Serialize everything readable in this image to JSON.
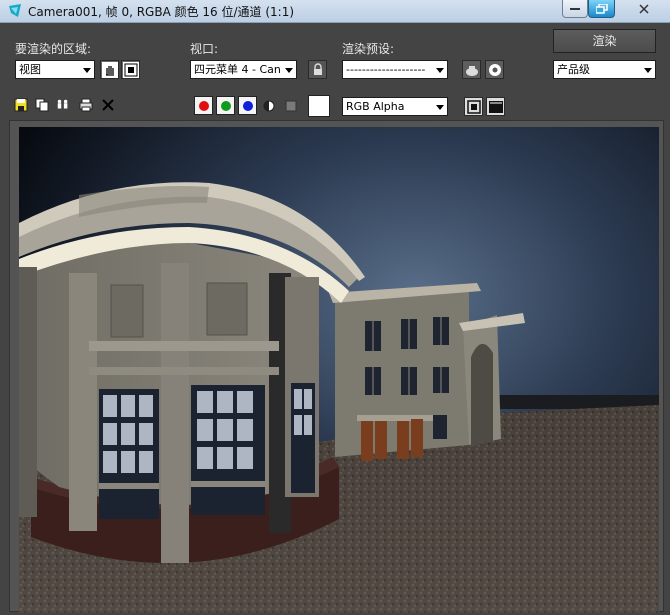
{
  "window": {
    "title": "Camera001, 帧 0, RGBA 颜色 16 位/通道 (1:1)"
  },
  "toolbar": {
    "area_label": "要渲染的区域:",
    "area_value": "视图",
    "viewport_label": "视口:",
    "viewport_value": "四元菜单 4 - Can",
    "preset_label": "渲染预设:",
    "preset_value": "--------------------",
    "render_button": "渲染",
    "quality_value": "产品级",
    "channel_value": "RGB Alpha"
  },
  "colors": {
    "channel_red": "#e01010",
    "channel_green": "#119b1d",
    "channel_blue": "#1020d8",
    "swatch": "#ffffff",
    "accent": "#1a88c9"
  }
}
